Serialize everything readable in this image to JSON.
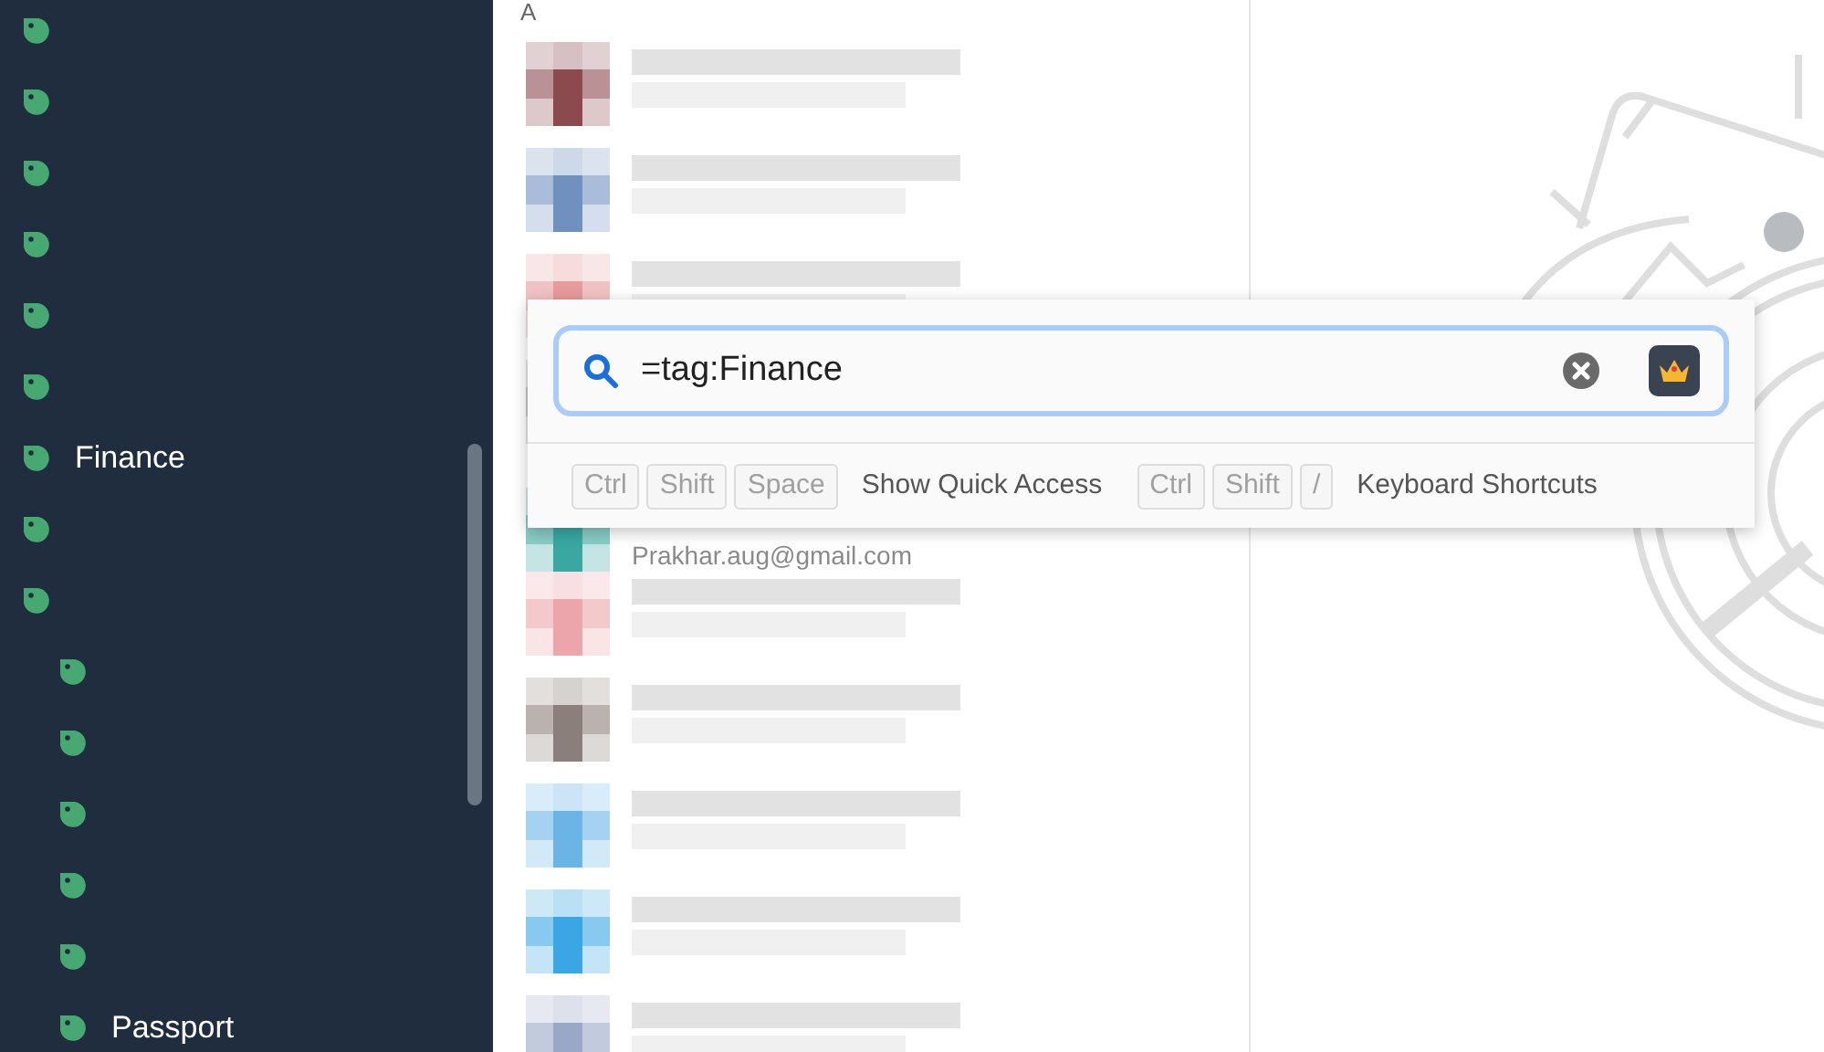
{
  "sidebar": {
    "tags": [
      {
        "color": "#48a872"
      },
      {
        "color": "#48a872"
      },
      {
        "color": "#48a872"
      },
      {
        "color": "#48a872"
      },
      {
        "color": "#48a872"
      },
      {
        "color": "#48a872"
      },
      {
        "color": "#48a872",
        "label": "Finance"
      },
      {
        "color": "#48a872"
      },
      {
        "color": "#48a872",
        "children": [
          {
            "color": "#48a872"
          },
          {
            "color": "#48a872"
          },
          {
            "color": "#48a872"
          },
          {
            "color": "#48a872"
          },
          {
            "color": "#48a872"
          },
          {
            "color": "#48a872",
            "label": "Passport"
          }
        ]
      }
    ]
  },
  "list": {
    "section": "A",
    "items": [
      {
        "color": "#8c4a4f"
      },
      {
        "color": "#7090c0"
      },
      {
        "color": "#e89a9c"
      },
      {
        "color": "#a0a0a0"
      },
      {
        "color": "#3aa8a0",
        "email": "Prakhar.aug@gmail.com"
      },
      {
        "color": "#eba5ab"
      },
      {
        "color": "#8a7f7a"
      },
      {
        "color": "#6ab4e6"
      },
      {
        "color": "#3aa6e4"
      },
      {
        "color": "#9aa8c8"
      }
    ]
  },
  "quick_access": {
    "query": "=tag:Finance",
    "shortcuts": [
      {
        "keys": [
          "Ctrl",
          "Shift",
          "Space"
        ],
        "label": "Show Quick Access"
      },
      {
        "keys": [
          "Ctrl",
          "Shift",
          "/"
        ],
        "label": "Keyboard Shortcuts"
      }
    ]
  }
}
